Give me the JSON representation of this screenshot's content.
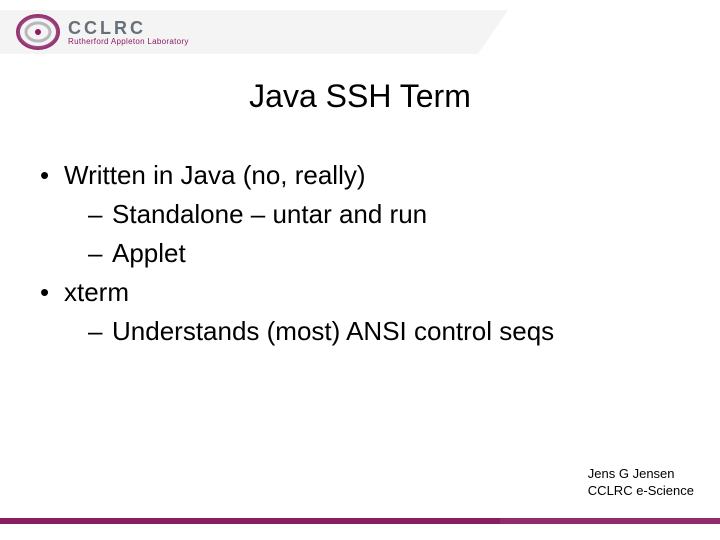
{
  "logo": {
    "name": "CCLRC",
    "subtitle": "Rutherford Appleton Laboratory"
  },
  "title": "Java SSH Term",
  "bullets": [
    {
      "level": 1,
      "text": "Written in Java (no, really)"
    },
    {
      "level": 2,
      "text": "Standalone – untar and run"
    },
    {
      "level": 2,
      "text": "Applet"
    },
    {
      "level": 1,
      "text": "xterm"
    },
    {
      "level": 2,
      "text": "Understands (most) ANSI control seqs"
    }
  ],
  "footer": {
    "author": "Jens G Jensen",
    "org": "CCLRC e-Science"
  },
  "colors": {
    "accent": "#8a1c63",
    "band": "#f4f4f4"
  }
}
